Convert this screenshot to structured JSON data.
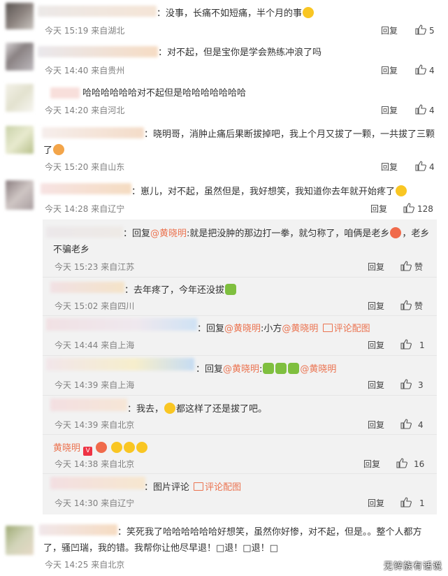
{
  "labels": {
    "reply": "回复",
    "like": "赞"
  },
  "comments": [
    {
      "text": "：没事，长痛不如短痛，半个月的事",
      "time": "今天 15:19 来自湖北",
      "likes": "5"
    },
    {
      "text": "：对不起，但是宝你是学会熟练冲浪了吗",
      "time": "今天 14:40 来自贵州",
      "likes": "4"
    },
    {
      "text": "哈哈哈哈哈哈对不起但是哈哈哈哈哈哈哈",
      "time": "今天 14:20 来自河北",
      "likes": "4"
    },
    {
      "text": "：晓明哥，消肿止痛后果断拔掉吧，我上个月又拔了一颗，一共拔了三颗",
      "text2": "了",
      "time": "今天 15:20 来自山东",
      "likes": "4"
    },
    {
      "text": "：崽儿，对不起，虽然但是，我好想笑，我知道你去年就开始疼了",
      "time": "今天 14:28 来自辽宁",
      "likes": "128"
    },
    {
      "text": "：笑死我了哈哈哈哈哈哈好想笑，虽然你好惨，对不起，但是。。整个人都方",
      "text2": "了，骚凹瑞，我的错。我帮你让他尽早退！□退！□退！□",
      "time": "今天 14:25 来自北京"
    }
  ],
  "replies": [
    {
      "pre": "：回复",
      "mention": "@黄晓明",
      "text": ":就是把没肿的那边打一拳，就匀称了，咱俩是老乡",
      "text_tail": "，老乡",
      "text2": "不骗老乡",
      "time": "今天 15:23 来自江苏",
      "likes": "赞"
    },
    {
      "text": "：去年疼了，今年还没拔",
      "time": "今天 15:02 来自四川",
      "likes": "赞"
    },
    {
      "pre": "：回复",
      "mention": "@黄晓明",
      "text": ":小方",
      "mention2": "@黄晓明",
      "pic_label": "评论配图",
      "time": "今天 14:44 来自上海",
      "likes": "1"
    },
    {
      "pre": "：回复",
      "mention": "@黄晓明",
      "text": ":",
      "mention2": "@黄晓明",
      "time": "今天 14:39 来自上海",
      "likes": "3"
    },
    {
      "text": "：我去，",
      "text_tail": "都这样了还是拔了吧。",
      "time": "今天 14:39 来自北京",
      "likes": "4"
    },
    {
      "name": "黄晓明",
      "time": "今天 14:38 来自北京",
      "likes": "16"
    },
    {
      "text": "：图片评论",
      "pic_label": "评论配图",
      "time": "今天 14:30 来自辽宁",
      "likes": "1"
    }
  ],
  "watermark": "无锌族有话说"
}
